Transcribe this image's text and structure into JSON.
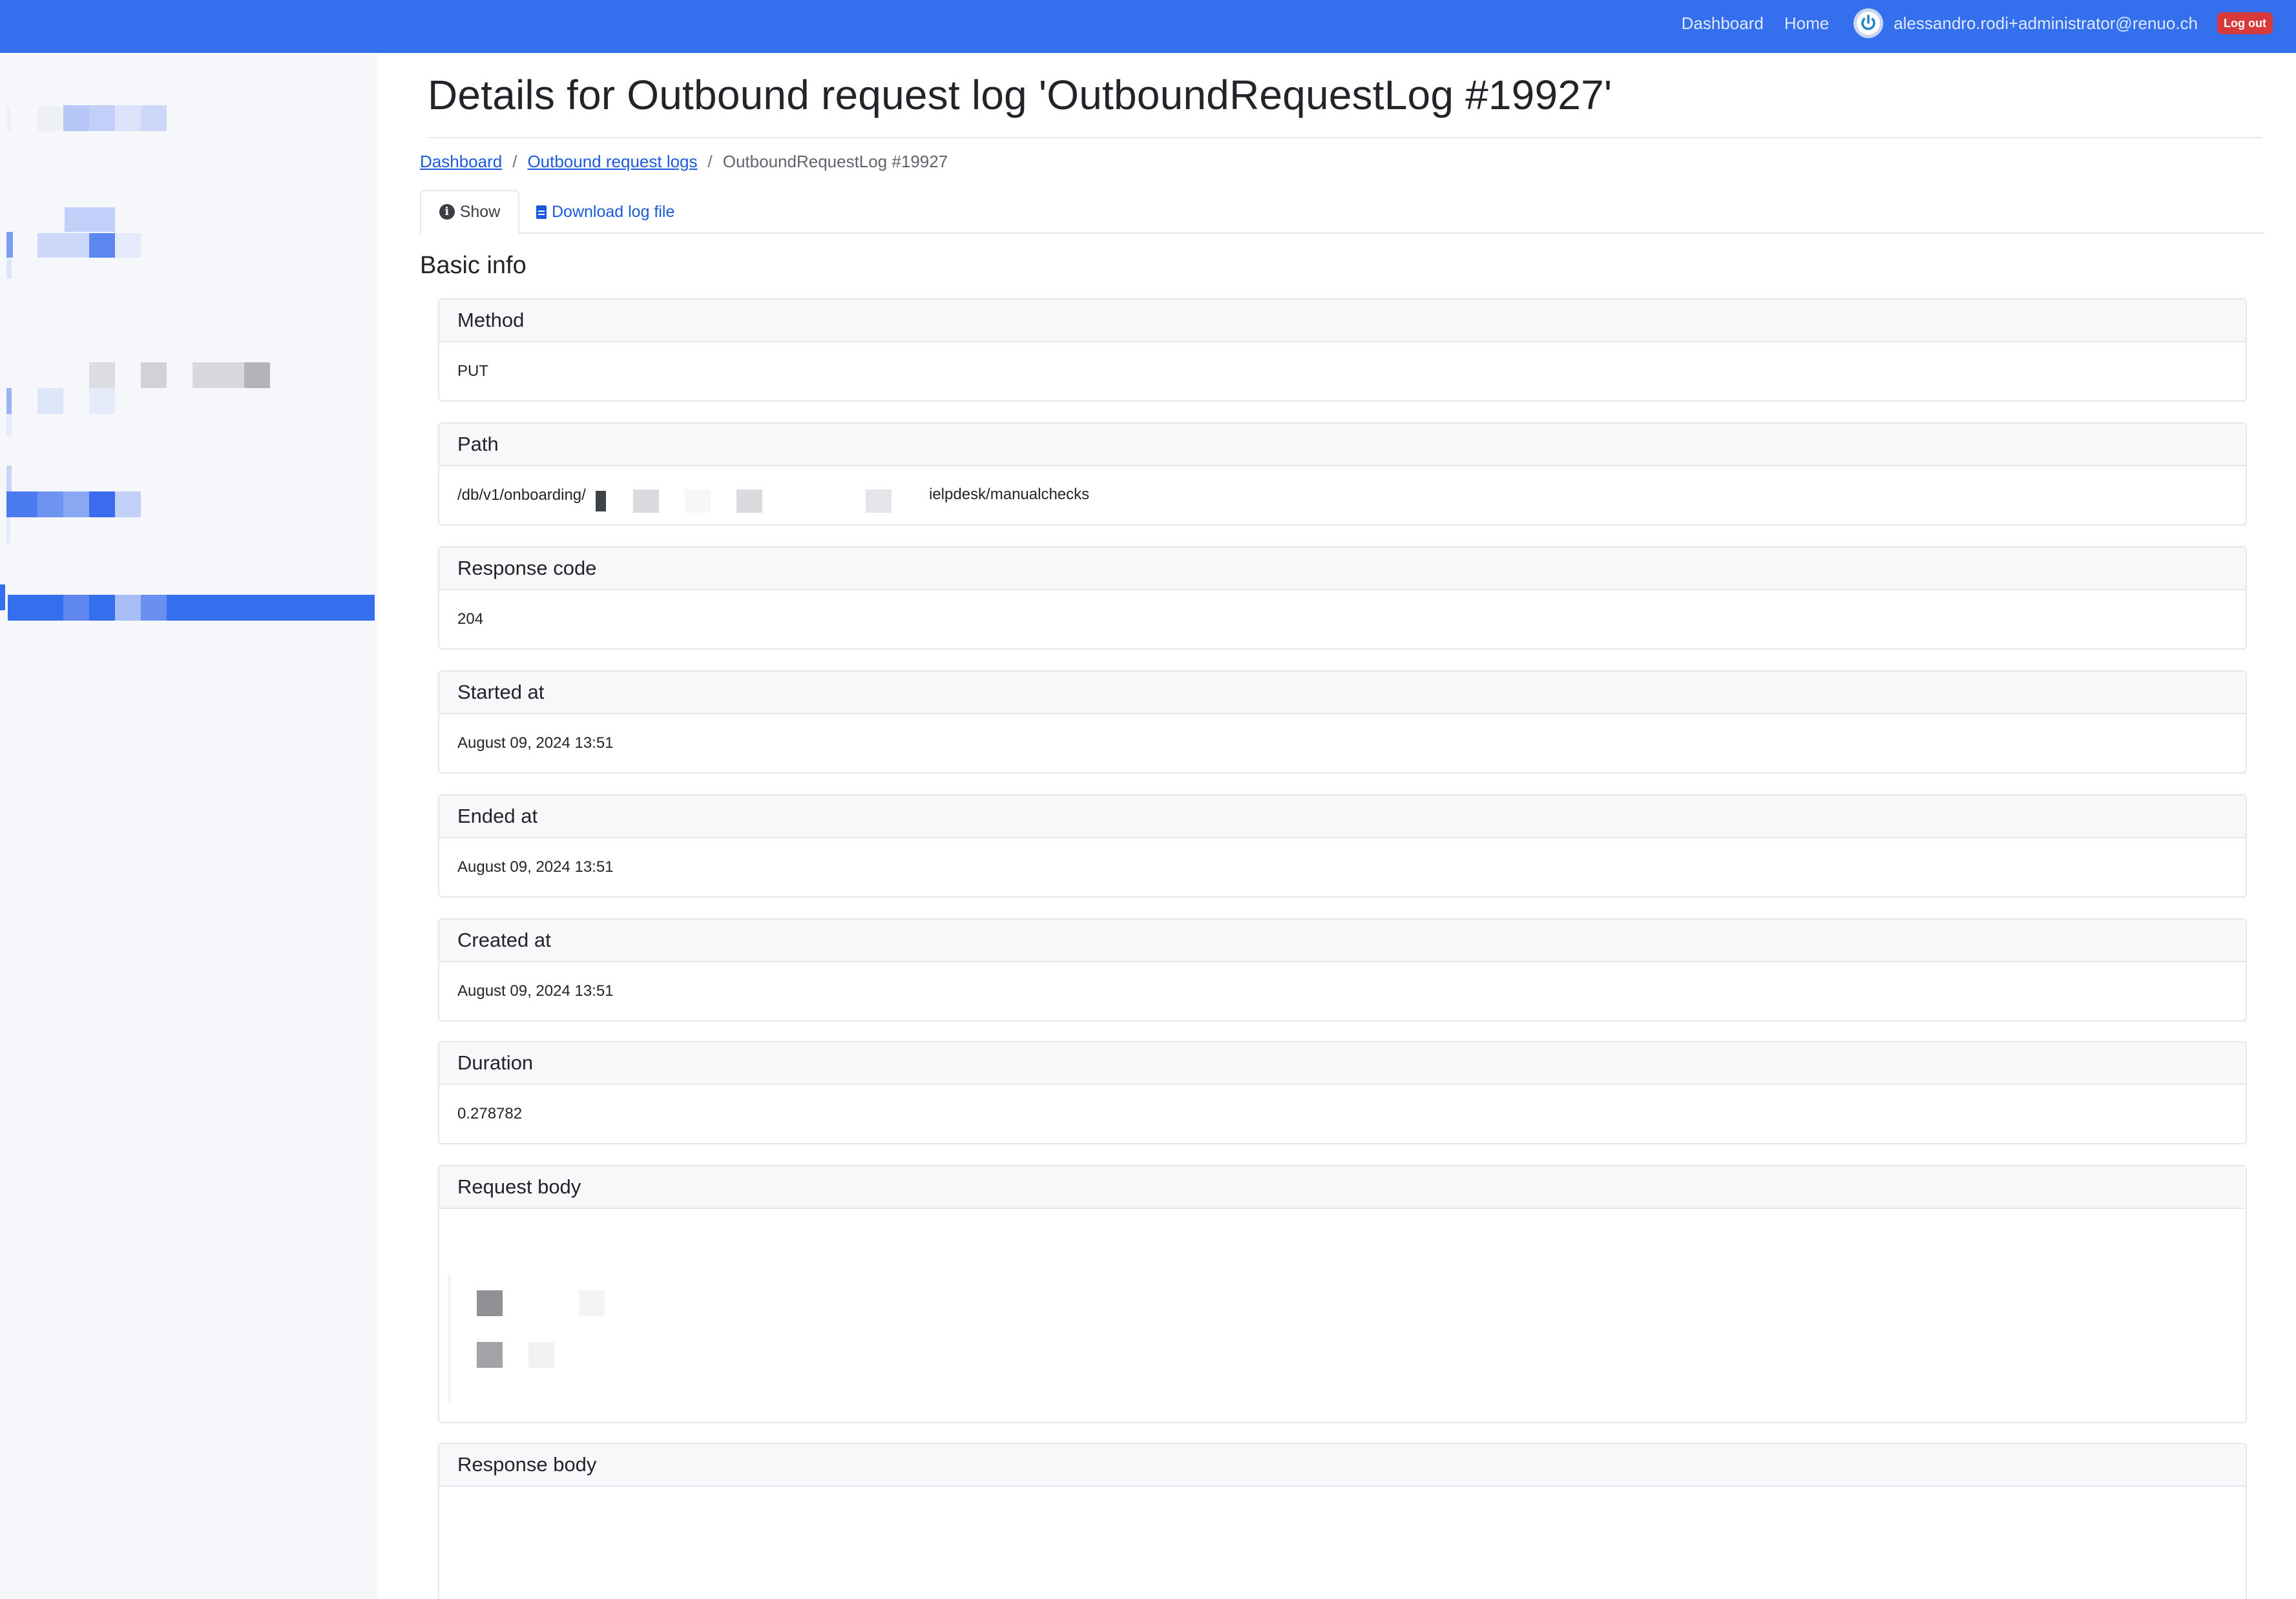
{
  "navbar": {
    "dashboard_link": "Dashboard",
    "home_link": "Home",
    "user_email": "alessandro.rodi+administrator@renuo.ch",
    "logout_label": "Log out",
    "user_icon": "power-icon",
    "bg_color": "#3470ee"
  },
  "page": {
    "title": "Details for Outbound request log 'OutboundRequestLog #19927'"
  },
  "breadcrumb": {
    "items": [
      "Dashboard",
      "Outbound request logs",
      "OutboundRequestLog #19927"
    ],
    "separator": "/"
  },
  "tabs": {
    "show_label": "Show",
    "show_icon": "info-circle-icon",
    "download_label": "Download log file",
    "download_icon": "file-icon"
  },
  "section": {
    "title": "Basic info"
  },
  "fields": [
    {
      "label": "Method",
      "value": "PUT"
    },
    {
      "label": "Path",
      "value_start": "/db/v1/onboarding/",
      "value_end": "ielpdesk/manualchecks"
    },
    {
      "label": "Response code",
      "value": "204"
    },
    {
      "label": "Started at",
      "value": "August 09, 2024 13:51"
    },
    {
      "label": "Ended at",
      "value": "August 09, 2024 13:51"
    },
    {
      "label": "Created at",
      "value": "August 09, 2024 13:51"
    },
    {
      "label": "Duration",
      "value": "0.278782"
    },
    {
      "label": "Request body",
      "value": ""
    },
    {
      "label": "Response body",
      "value": ""
    }
  ]
}
